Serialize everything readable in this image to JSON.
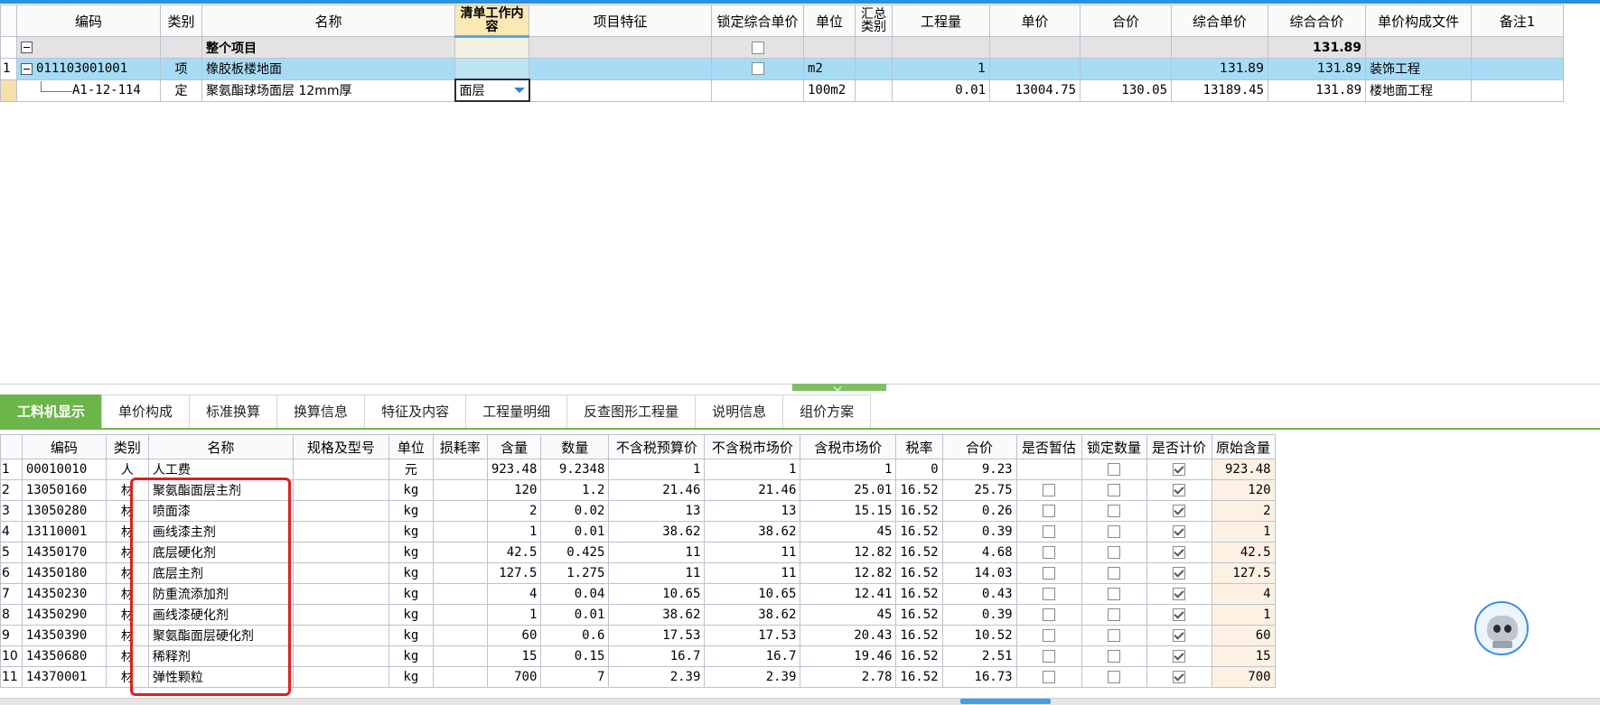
{
  "top": {
    "headers": [
      "编码",
      "类别",
      "名称",
      "清单工作内容",
      "项目特征",
      "锁定综合单价",
      "单位",
      "汇总类别",
      "工程量",
      "单价",
      "合价",
      "综合单价",
      "综合合价",
      "单价构成文件",
      "备注1"
    ],
    "row_all": {
      "name": "整个项目",
      "total": "131.89"
    },
    "row1": {
      "no": "1",
      "code": "011103001001",
      "type": "项",
      "name": "橡胶板楼地面",
      "unit": "m2",
      "qty": "1",
      "comp_price": "131.89",
      "comp_total": "131.89",
      "file": "装饰工程"
    },
    "row2": {
      "code": "A1-12-114",
      "type": "定",
      "name": "聚氨酯球场面层 12mm厚",
      "content": "面层",
      "unit": "100m2",
      "qty": "0.01",
      "price": "13004.75",
      "amount": "130.05",
      "comp_price": "13189.45",
      "comp_total": "131.89",
      "file": "楼地面工程"
    }
  },
  "tabs": [
    "工料机显示",
    "单价构成",
    "标准换算",
    "换算信息",
    "特征及内容",
    "工程量明细",
    "反查图形工程量",
    "说明信息",
    "组价方案"
  ],
  "bottom": {
    "headers": [
      "编码",
      "类别",
      "名称",
      "规格及型号",
      "单位",
      "损耗率",
      "含量",
      "数量",
      "不含税预算价",
      "不含税市场价",
      "含税市场价",
      "税率",
      "合价",
      "是否暂估",
      "锁定数量",
      "是否计价",
      "原始含量"
    ],
    "rows": [
      {
        "no": "1",
        "code": "00010010",
        "type": "人",
        "name": "人工费",
        "unit": "元",
        "content": "923.48",
        "qty": "9.2348",
        "budget": "1",
        "market": "1",
        "tax_market": "1",
        "rate": "0",
        "amount": "9.23",
        "orig": "923.48",
        "est": false
      },
      {
        "no": "2",
        "code": "13050160",
        "type": "材",
        "name": "聚氨酯面层主剂",
        "unit": "kg",
        "content": "120",
        "qty": "1.2",
        "budget": "21.46",
        "market": "21.46",
        "tax_market": "25.01",
        "rate": "16.52",
        "amount": "25.75",
        "orig": "120",
        "est": true
      },
      {
        "no": "3",
        "code": "13050280",
        "type": "材",
        "name": "喷面漆",
        "unit": "kg",
        "content": "2",
        "qty": "0.02",
        "budget": "13",
        "market": "13",
        "tax_market": "15.15",
        "rate": "16.52",
        "amount": "0.26",
        "orig": "2",
        "est": true
      },
      {
        "no": "4",
        "code": "13110001",
        "type": "材",
        "name": "画线漆主剂",
        "unit": "kg",
        "content": "1",
        "qty": "0.01",
        "budget": "38.62",
        "market": "38.62",
        "tax_market": "45",
        "rate": "16.52",
        "amount": "0.39",
        "orig": "1",
        "est": true
      },
      {
        "no": "5",
        "code": "14350170",
        "type": "材",
        "name": "底层硬化剂",
        "unit": "kg",
        "content": "42.5",
        "qty": "0.425",
        "budget": "11",
        "market": "11",
        "tax_market": "12.82",
        "rate": "16.52",
        "amount": "4.68",
        "orig": "42.5",
        "est": true
      },
      {
        "no": "6",
        "code": "14350180",
        "type": "材",
        "name": "底层主剂",
        "unit": "kg",
        "content": "127.5",
        "qty": "1.275",
        "budget": "11",
        "market": "11",
        "tax_market": "12.82",
        "rate": "16.52",
        "amount": "14.03",
        "orig": "127.5",
        "est": true
      },
      {
        "no": "7",
        "code": "14350230",
        "type": "材",
        "name": "防重流添加剂",
        "unit": "kg",
        "content": "4",
        "qty": "0.04",
        "budget": "10.65",
        "market": "10.65",
        "tax_market": "12.41",
        "rate": "16.52",
        "amount": "0.43",
        "orig": "4",
        "est": true
      },
      {
        "no": "8",
        "code": "14350290",
        "type": "材",
        "name": "画线漆硬化剂",
        "unit": "kg",
        "content": "1",
        "qty": "0.01",
        "budget": "38.62",
        "market": "38.62",
        "tax_market": "45",
        "rate": "16.52",
        "amount": "0.39",
        "orig": "1",
        "est": true
      },
      {
        "no": "9",
        "code": "14350390",
        "type": "材",
        "name": "聚氨酯面层硬化剂",
        "unit": "kg",
        "content": "60",
        "qty": "0.6",
        "budget": "17.53",
        "market": "17.53",
        "tax_market": "20.43",
        "rate": "16.52",
        "amount": "10.52",
        "orig": "60",
        "est": true
      },
      {
        "no": "10",
        "code": "14350680",
        "type": "材",
        "name": "稀释剂",
        "unit": "kg",
        "content": "15",
        "qty": "0.15",
        "budget": "16.7",
        "market": "16.7",
        "tax_market": "19.46",
        "rate": "16.52",
        "amount": "2.51",
        "orig": "15",
        "est": true
      },
      {
        "no": "11",
        "code": "14370001",
        "type": "材",
        "name": "弹性颗粒",
        "unit": "kg",
        "content": "700",
        "qty": "7",
        "budget": "2.39",
        "market": "2.39",
        "tax_market": "2.78",
        "rate": "16.52",
        "amount": "16.73",
        "orig": "700",
        "est": true
      }
    ]
  }
}
